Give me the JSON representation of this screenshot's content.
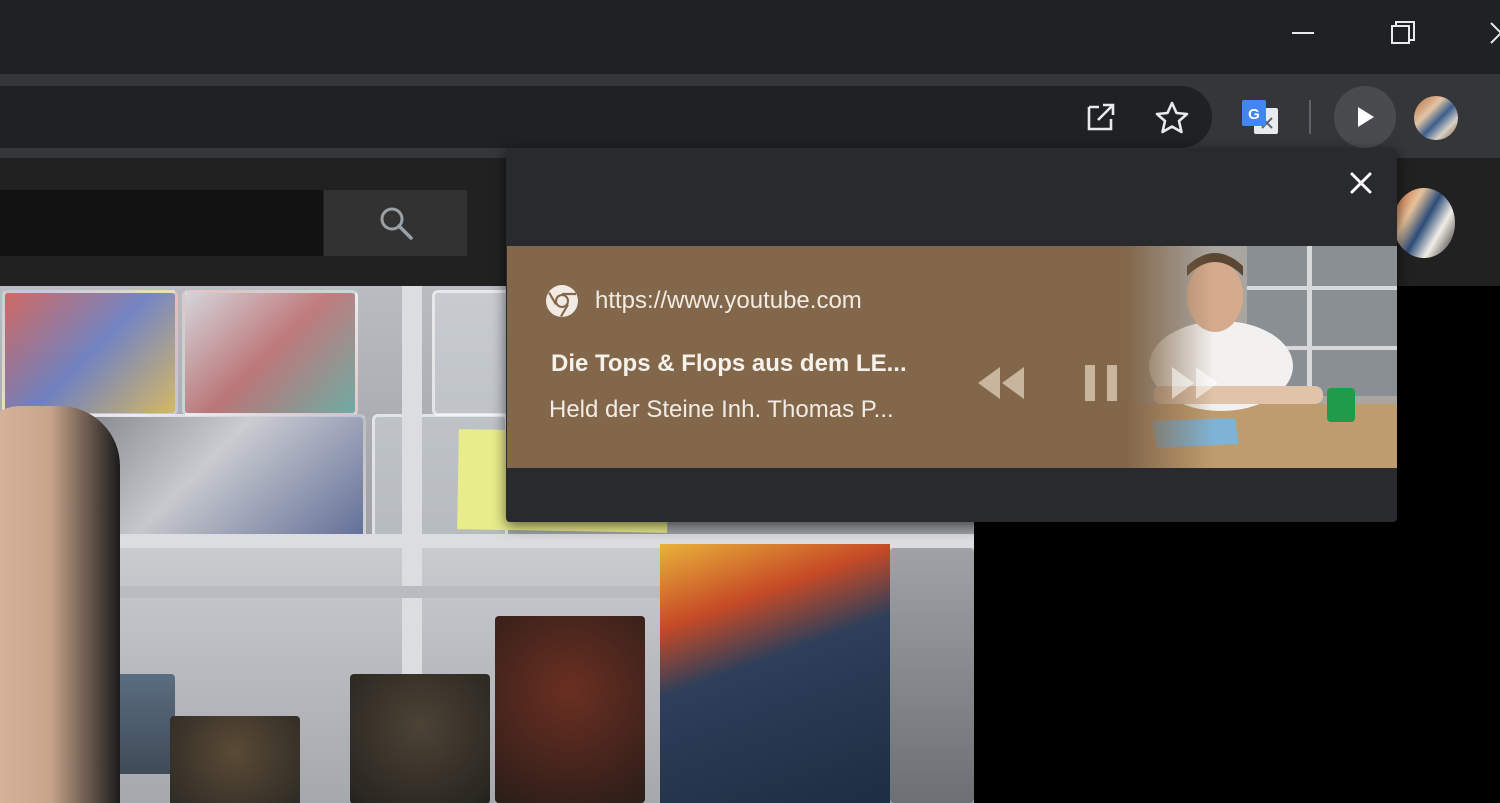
{
  "media_popup": {
    "source_url": "https://www.youtube.com",
    "title": "Die Tops & Flops aus dem LE...",
    "artist": "Held der Steine Inh. Thomas P..."
  },
  "colors": {
    "titlebar": "#202124",
    "toolbar": "#35363a",
    "popup_bg": "#292a2d",
    "card_bg": "#83674b"
  },
  "icons": {
    "minimize": "minimize-icon",
    "restore": "restore-icon",
    "close": "close-icon",
    "open_in_tab": "open-in-tab-icon",
    "bookmark": "star-icon",
    "translate": "google-translate-icon",
    "media": "play-icon",
    "search": "search-icon",
    "source": "chrome-icon",
    "previous": "rewind-icon",
    "pause": "pause-icon",
    "next": "fast-forward-icon"
  }
}
